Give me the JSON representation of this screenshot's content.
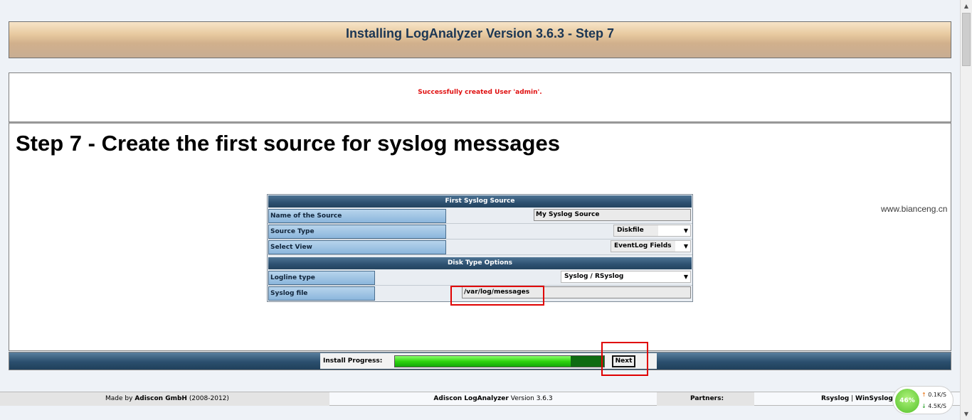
{
  "header": {
    "title": "Installing LogAnalyzer Version 3.6.3 - Step 7"
  },
  "message": {
    "text": "Successfully created User 'admin'."
  },
  "main": {
    "heading": "Step 7 - Create the first source for syslog messages"
  },
  "form": {
    "section1_title": "First Syslog Source",
    "source_name_label": "Name of the Source",
    "source_name_value": "My Syslog Source",
    "source_type_label": "Source Type",
    "source_type_value": "Diskfile",
    "select_view_label": "Select View",
    "select_view_value": "EventLog Fields",
    "section2_title": "Disk Type Options",
    "logline_type_label": "Logline type",
    "logline_type_value": "Syslog / RSyslog",
    "syslog_file_label": "Syslog file",
    "syslog_file_value": "/var/log/messages"
  },
  "progress": {
    "label": "Install Progress:",
    "fraction": 0.84,
    "next_label": "Next"
  },
  "footer": {
    "made_by_prefix": "Made by",
    "company": "Adiscon GmbH",
    "years": "(2008-2012)",
    "product": "Adiscon LogAnalyzer",
    "version": "Version 3.6.3",
    "partners_label": "Partners:",
    "partner1": "Rsyslog",
    "separator": "|",
    "partner2": "WinSyslog"
  },
  "watermark": "www.bianceng.cn",
  "net_widget": {
    "percent": "46%",
    "upload": "0.1K/S",
    "download": "4.5K/S"
  }
}
